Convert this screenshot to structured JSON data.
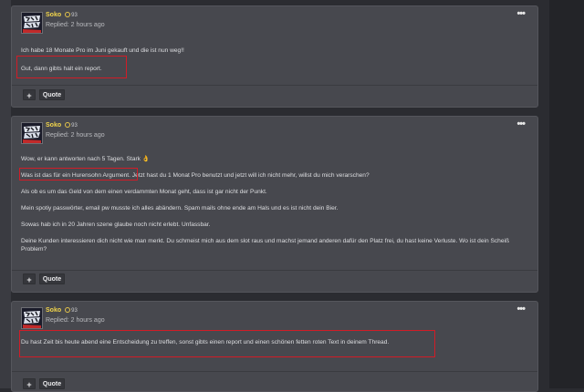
{
  "posts": [
    {
      "user": "Soko",
      "rep": "93",
      "time": "Replied: 2 hours ago",
      "paragraphs": [
        "Ich habe 18 Monate Pro im Juni gekauft und die ist nun weg!!",
        "Gut, dann gibts halt ein report."
      ]
    },
    {
      "user": "Soko",
      "rep": "93",
      "time": "Replied: 2 hours ago",
      "paragraphs": [
        "Wow, er kann antworten nach 5 Tagen. Stark 👌",
        "Was ist das für ein Hurensohn Argument. Jetzt hast du 1 Monat Pro benutzt und jetzt will ich nicht mehr, willst du mich verarschen?",
        "Als ob es um das Geld von dem einen verdammten Monat geht, dass ist gar nicht der Punkt.",
        "Mein spotiy passwörter, email pw musste ich alles abändern. Spam mails ohne ende am Hals und es ist nicht dein Bier.",
        "Sowas hab ich in 20 Jahren szene glaube noch nicht erlebt. Unfassbar.",
        "Deine Kunden interessieren dich nicht wie man merkt. Du schmeist mich aus dem slot raus und machst jemand anderen dafür den Platz frei, du hast keine Verluste. Wo ist dein Scheiß Problem?"
      ]
    },
    {
      "user": "Soko",
      "rep": "93",
      "time": "Replied: 2 hours ago",
      "paragraphs": [
        "Du hast Zeit bis heute abend eine Entscheidung zu treffen, sonst gibts einen report und einen schönen fetten roten Text in deinem Thread."
      ]
    }
  ],
  "actions": {
    "plus": "+",
    "quote": "Quote"
  },
  "menu_label": "•••",
  "colors": {
    "highlight": "#d11c27",
    "username": "#f3d64b"
  }
}
